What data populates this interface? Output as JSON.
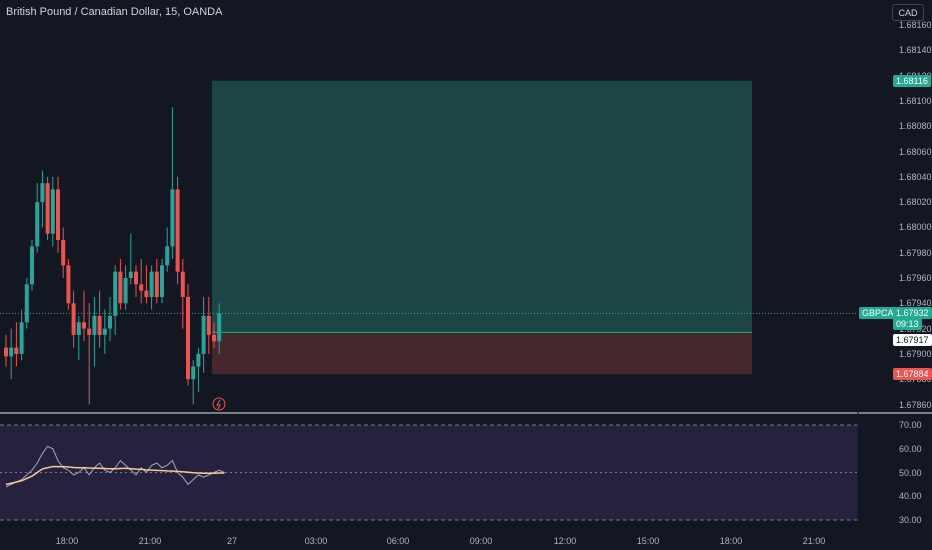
{
  "header": {
    "title": "British Pound / Canadian Dollar, 15, OANDA",
    "currency_button": "CAD"
  },
  "colors": {
    "background": "#131722",
    "bull": "#26a69a",
    "bear": "#ef5350",
    "profit_zone": "#1e4d4b",
    "loss_zone": "#4b2a2e",
    "rsi_bg": "#2a2542",
    "rsi_line": "#787b86",
    "rsi_ma": "#f6c89f"
  },
  "price_axis": {
    "ticks": [
      "1.68160",
      "1.68140",
      "1.68120",
      "1.68100",
      "1.68080",
      "1.68060",
      "1.68040",
      "1.68020",
      "1.68000",
      "1.67980",
      "1.67960",
      "1.67940",
      "1.67920",
      "1.67900",
      "1.67880",
      "1.67860"
    ]
  },
  "price_labels": {
    "target": "1.68116",
    "symbol": "GBPCAD",
    "current": "1.67932",
    "countdown": "09:13",
    "entry": "1.67917",
    "stop": "1.67884"
  },
  "rsi_axis": {
    "ticks": [
      "70.00",
      "60.00",
      "50.00",
      "40.00",
      "30.00"
    ]
  },
  "time_axis": {
    "ticks": [
      "18:00",
      "21:00",
      "27",
      "03:00",
      "06:00",
      "09:00",
      "12:00",
      "15:00",
      "18:00",
      "21:00"
    ]
  },
  "position": {
    "type": "long",
    "entry": 1.67917,
    "target": 1.68116,
    "stop": 1.67884
  },
  "chart_data": {
    "type": "candlestick",
    "title": "British Pound / Canadian Dollar, 15, OANDA",
    "ylim": [
      1.6785,
      1.6817
    ],
    "candles": [
      [
        1.67905,
        1.67915,
        1.6789,
        1.67898
      ],
      [
        1.67898,
        1.6792,
        1.6788,
        1.67905
      ],
      [
        1.67905,
        1.67925,
        1.6789,
        1.679
      ],
      [
        1.679,
        1.67935,
        1.67895,
        1.67925
      ],
      [
        1.67925,
        1.6796,
        1.6792,
        1.67955
      ],
      [
        1.67955,
        1.6799,
        1.6795,
        1.67985
      ],
      [
        1.67985,
        1.68035,
        1.6798,
        1.6802
      ],
      [
        1.6802,
        1.68045,
        1.68,
        1.68035
      ],
      [
        1.68035,
        1.6804,
        1.6799,
        1.67995
      ],
      [
        1.67995,
        1.6804,
        1.67985,
        1.6803
      ],
      [
        1.6803,
        1.6804,
        1.6798,
        1.6799
      ],
      [
        1.6799,
        1.68,
        1.6796,
        1.6797
      ],
      [
        1.6797,
        1.67975,
        1.67935,
        1.6794
      ],
      [
        1.6794,
        1.6795,
        1.67905,
        1.67915
      ],
      [
        1.67915,
        1.6793,
        1.67895,
        1.67925
      ],
      [
        1.67925,
        1.6795,
        1.6791,
        1.6792
      ],
      [
        1.6792,
        1.6794,
        1.6786,
        1.67915
      ],
      [
        1.67915,
        1.67945,
        1.6789,
        1.6793
      ],
      [
        1.6793,
        1.6795,
        1.67905,
        1.67915
      ],
      [
        1.67915,
        1.67935,
        1.679,
        1.6792
      ],
      [
        1.6792,
        1.67945,
        1.6791,
        1.6793
      ],
      [
        1.6793,
        1.6797,
        1.67915,
        1.67965
      ],
      [
        1.67965,
        1.67975,
        1.67935,
        1.6794
      ],
      [
        1.6794,
        1.6797,
        1.67935,
        1.6796
      ],
      [
        1.6796,
        1.67995,
        1.67955,
        1.67965
      ],
      [
        1.67965,
        1.6797,
        1.67945,
        1.67955
      ],
      [
        1.67955,
        1.67975,
        1.6794,
        1.6795
      ],
      [
        1.6795,
        1.6797,
        1.6794,
        1.67945
      ],
      [
        1.67945,
        1.6797,
        1.67935,
        1.67965
      ],
      [
        1.67965,
        1.67975,
        1.6794,
        1.67945
      ],
      [
        1.67945,
        1.67975,
        1.6794,
        1.6797
      ],
      [
        1.6797,
        1.68,
        1.67965,
        1.67985
      ],
      [
        1.67985,
        1.68095,
        1.67975,
        1.6803
      ],
      [
        1.6803,
        1.6804,
        1.67955,
        1.67965
      ],
      [
        1.67965,
        1.67975,
        1.6792,
        1.67945
      ],
      [
        1.67945,
        1.67955,
        1.67875,
        1.6788
      ],
      [
        1.6788,
        1.67895,
        1.6786,
        1.6789
      ],
      [
        1.6789,
        1.67905,
        1.6787,
        1.679
      ],
      [
        1.679,
        1.67945,
        1.67885,
        1.6793
      ],
      [
        1.6793,
        1.67945,
        1.679,
        1.67915
      ],
      [
        1.67915,
        1.67925,
        1.67905,
        1.6791
      ],
      [
        1.6791,
        1.6794,
        1.679,
        1.67932
      ]
    ],
    "rsi": [
      44,
      45,
      46,
      47,
      49,
      51,
      54,
      58,
      61,
      60,
      55,
      52,
      51,
      49,
      50,
      52,
      49,
      52,
      54,
      51,
      50,
      52,
      55,
      53,
      51,
      49,
      52,
      50,
      53,
      54,
      52,
      53,
      55,
      50,
      48,
      45,
      47,
      49,
      48,
      49,
      50,
      51,
      50
    ],
    "rsi_ma": [
      45,
      45.5,
      46,
      46.5,
      47.5,
      48.5,
      50,
      51.5,
      52,
      52.5,
      52.5,
      52.5,
      52.3,
      52.1,
      52,
      52,
      51.9,
      51.8,
      51.8,
      51.7,
      51.6,
      51.6,
      51.7,
      51.8,
      51.6,
      51.4,
      51.3,
      51.1,
      51,
      50.9,
      50.8,
      50.7,
      50.6,
      50.5,
      50.3,
      50.1,
      49.9,
      49.8,
      49.7,
      49.7,
      49.7,
      49.8,
      49.8
    ],
    "rsi_range": [
      25,
      75
    ]
  }
}
